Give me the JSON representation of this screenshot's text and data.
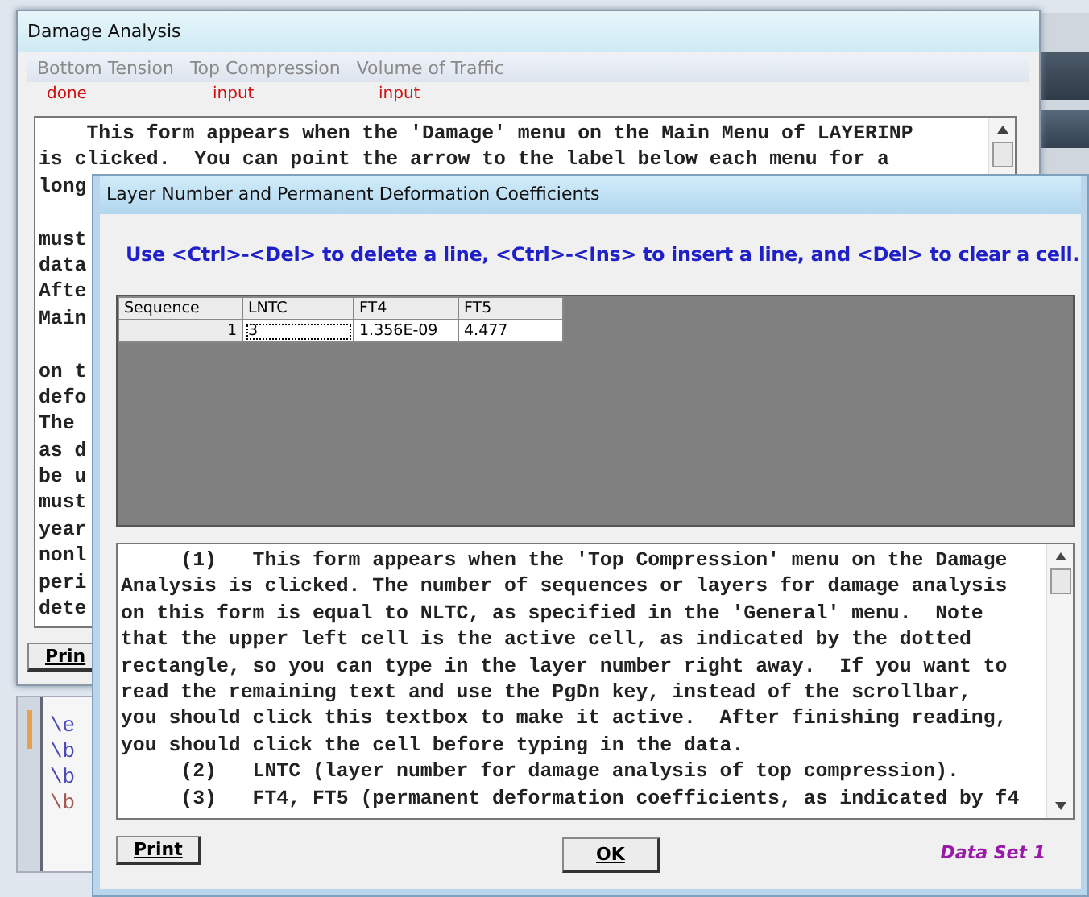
{
  "background_window": {
    "title": "Damage Analysis",
    "menu": [
      {
        "label": "Bottom Tension",
        "status": "done"
      },
      {
        "label": "Top Compression",
        "status": "input"
      },
      {
        "label": "Volume of Traffic",
        "status": "input"
      }
    ],
    "help_paragraphs": [
      [
        "    This form appears when the 'Damage' menu on the Main Menu of LAYERINP",
        "is clicked.  You can point the arrow to the label below each menu for a",
        "long"
      ],
      [
        "must",
        "data",
        "Afte",
        "Main"
      ],
      [
        "on t",
        "defo",
        "The",
        "as d",
        "be u",
        "must",
        "year",
        "nonl",
        "peri",
        "dete"
      ]
    ],
    "print_button": "Prin"
  },
  "code_editor": {
    "lines": [
      {
        "text": "\\e",
        "color": "#4a4ab8"
      },
      {
        "text": "\\b",
        "color": "#4a4ab8"
      },
      {
        "text": "\\b",
        "color": "#4a4ab8"
      },
      {
        "text": "\\b",
        "color": "#a05a50"
      }
    ]
  },
  "front_window": {
    "title": "Layer Number and Permanent Deformation Coefficients",
    "instruction": "Use <Ctrl>-<Del> to delete a line, <Ctrl>-<Ins> to insert a line, and <Del> to clear a cell.",
    "table": {
      "columns": [
        "Sequence",
        "LNTC",
        "FT4",
        "FT5"
      ],
      "rows": [
        [
          {
            "text": "1",
            "active": false
          },
          {
            "text": "3",
            "active": true
          },
          {
            "text": "1.356E-09",
            "active": false
          },
          {
            "text": "4.477",
            "active": false
          }
        ]
      ]
    },
    "help_text": [
      "     (1)   This form appears when the 'Top Compression' menu on the Damage",
      "Analysis is clicked. The number of sequences or layers for damage analysis",
      "on this form is equal to NLTC, as specified in the 'General' menu.  Note",
      "that the upper left cell is the active cell, as indicated by the dotted",
      "rectangle, so you can type in the layer number right away.  If you want to",
      "read the remaining text and use the PgDn key, instead of the scrollbar,",
      "you should click this textbox to make it active.  After finishing reading,",
      "you should click the cell before typing in the data.",
      "     (2)   LNTC (layer number for damage analysis of top compression).",
      "     (3)   FT4, FT5 (permanent deformation coefficients, as indicated by f4"
    ],
    "print_button": "Print",
    "ok_button": "OK",
    "data_set_label": "Data Set 1"
  }
}
